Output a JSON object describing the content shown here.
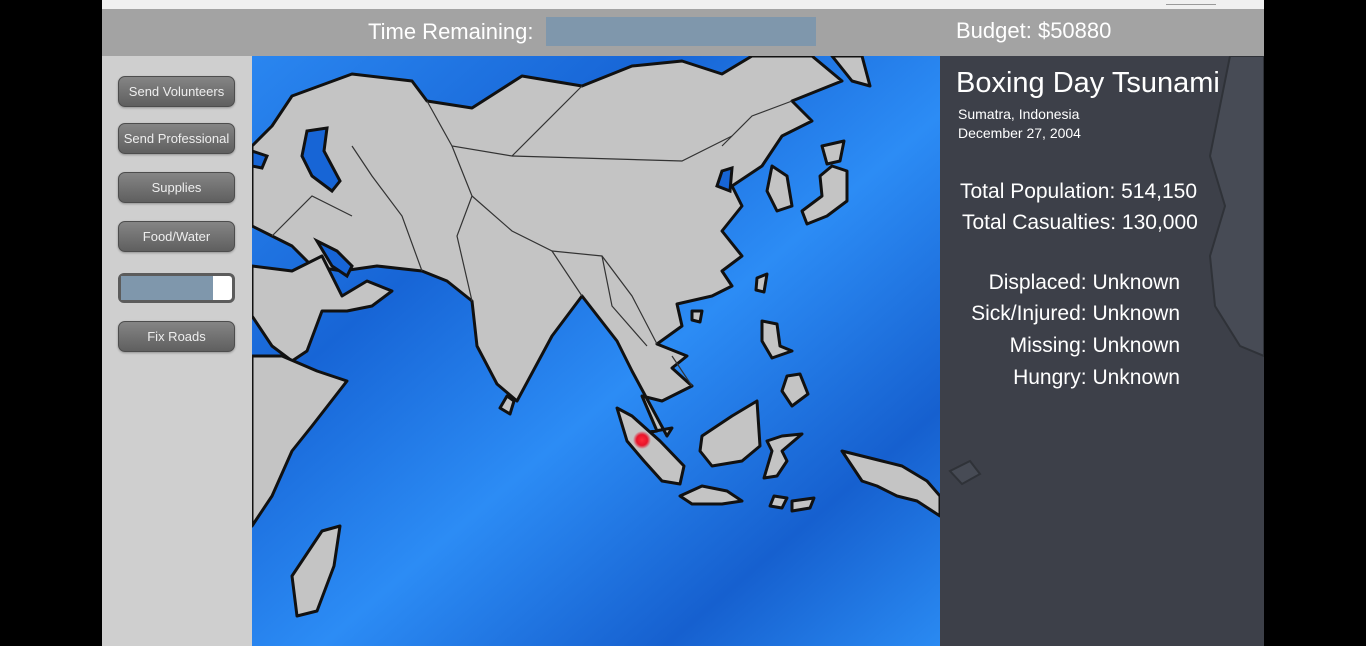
{
  "header": {
    "time_label": "Time Remaining:",
    "time_progress": 1.0,
    "budget": "Budget: $50880"
  },
  "sidebar": {
    "buttons": {
      "send_volunteers": "Send Volunteers",
      "send_professional": "Send Professional",
      "supplies": "Supplies",
      "food_water": "Food/Water",
      "fix_roads": "Fix Roads"
    },
    "progress_fraction": 0.83
  },
  "map": {
    "region": "South and Southeast Asia",
    "marker": "red-location-dot",
    "colors": {
      "ocean": "#1a6fe0",
      "land": "#c4c4c4",
      "marker": "#e8142a"
    }
  },
  "info": {
    "title": "Boxing Day Tsunami",
    "location": "Sumatra, Indonesia",
    "date": "December 27, 2004",
    "total_population": "Total Population: 514,150",
    "total_casualties": "Total Casualties: 130,000",
    "displaced": "Displaced: Unknown",
    "sick_injured": "Sick/Injured: Unknown",
    "missing": "Missing: Unknown",
    "hungry": "Hungry: Unknown"
  },
  "colors": {
    "header_bg": "#a3a3a3",
    "bar_fill": "#7f97ac",
    "sidebar_bg": "#cfcfcf",
    "info_bg": "#3d4049"
  }
}
